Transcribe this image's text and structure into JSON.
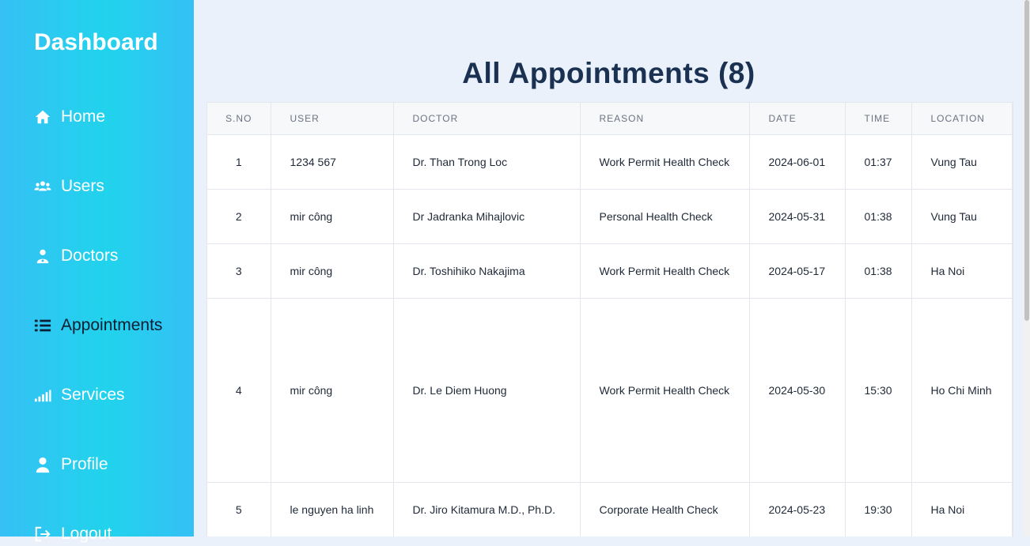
{
  "sidebar": {
    "brand": "Dashboard",
    "items": [
      {
        "label": "Home",
        "icon": "home-icon"
      },
      {
        "label": "Users",
        "icon": "users-icon"
      },
      {
        "label": "Doctors",
        "icon": "doctor-icon"
      },
      {
        "label": "Appointments",
        "icon": "list-icon"
      },
      {
        "label": "Services",
        "icon": "signal-icon"
      },
      {
        "label": "Profile",
        "icon": "user-icon"
      },
      {
        "label": "Logout",
        "icon": "logout-icon"
      }
    ],
    "active": "Appointments"
  },
  "main": {
    "title": "All Appointments (8)",
    "table": {
      "columns": [
        "S.NO",
        "USER",
        "DOCTOR",
        "REASON",
        "DATE",
        "TIME",
        "LOCATION"
      ],
      "rows": [
        [
          "1",
          "1234 567",
          "Dr. Than Trong Loc",
          "Work Permit Health Check",
          "2024-06-01",
          "01:37",
          "Vung Tau"
        ],
        [
          "2",
          "mir công",
          "Dr Jadranka Mihajlovic",
          "Personal Health Check",
          "2024-05-31",
          "01:38",
          "Vung Tau"
        ],
        [
          "3",
          "mir công",
          "Dr. Toshihiko Nakajima",
          "Work Permit Health Check",
          "2024-05-17",
          "01:38",
          "Ha Noi"
        ],
        [
          "4",
          "mir công",
          "Dr. Le Diem Huong",
          "Work Permit Health Check",
          "2024-05-30",
          "15:30",
          "Ho Chi Minh"
        ],
        [
          "5",
          "le nguyen ha linh",
          "Dr. Jiro Kitamura M.D., Ph.D.",
          "Corporate Health Check",
          "2024-05-23",
          "19:30",
          "Ha Noi"
        ]
      ]
    }
  },
  "colors": {
    "sidebar_gradient_start": "#36c0f5",
    "sidebar_gradient_mid": "#21d3ec",
    "main_background": "#eaf1fb",
    "title": "#1a3151"
  }
}
